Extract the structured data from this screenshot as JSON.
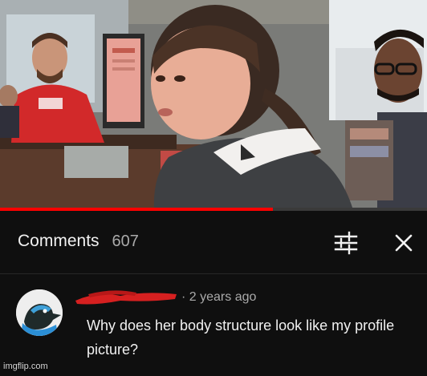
{
  "video": {
    "progress_fraction": 0.64,
    "progress_color": "#ff0000"
  },
  "comments": {
    "title": "Comments",
    "count": "607",
    "sort_icon": "sort-filter-icon",
    "close_icon": "close-icon"
  },
  "comment": {
    "author": "",
    "time": "· 2 years ago",
    "text": "Why does her body structure look like my profile picture?",
    "avatar_icon": "cartoon-duck-avatar"
  },
  "watermark": "imgflip.com",
  "colors": {
    "panel_bg": "#0f0f0f",
    "text_primary": "#f1f1f1",
    "text_secondary": "#aaaaaa",
    "redaction": "#d62020"
  }
}
